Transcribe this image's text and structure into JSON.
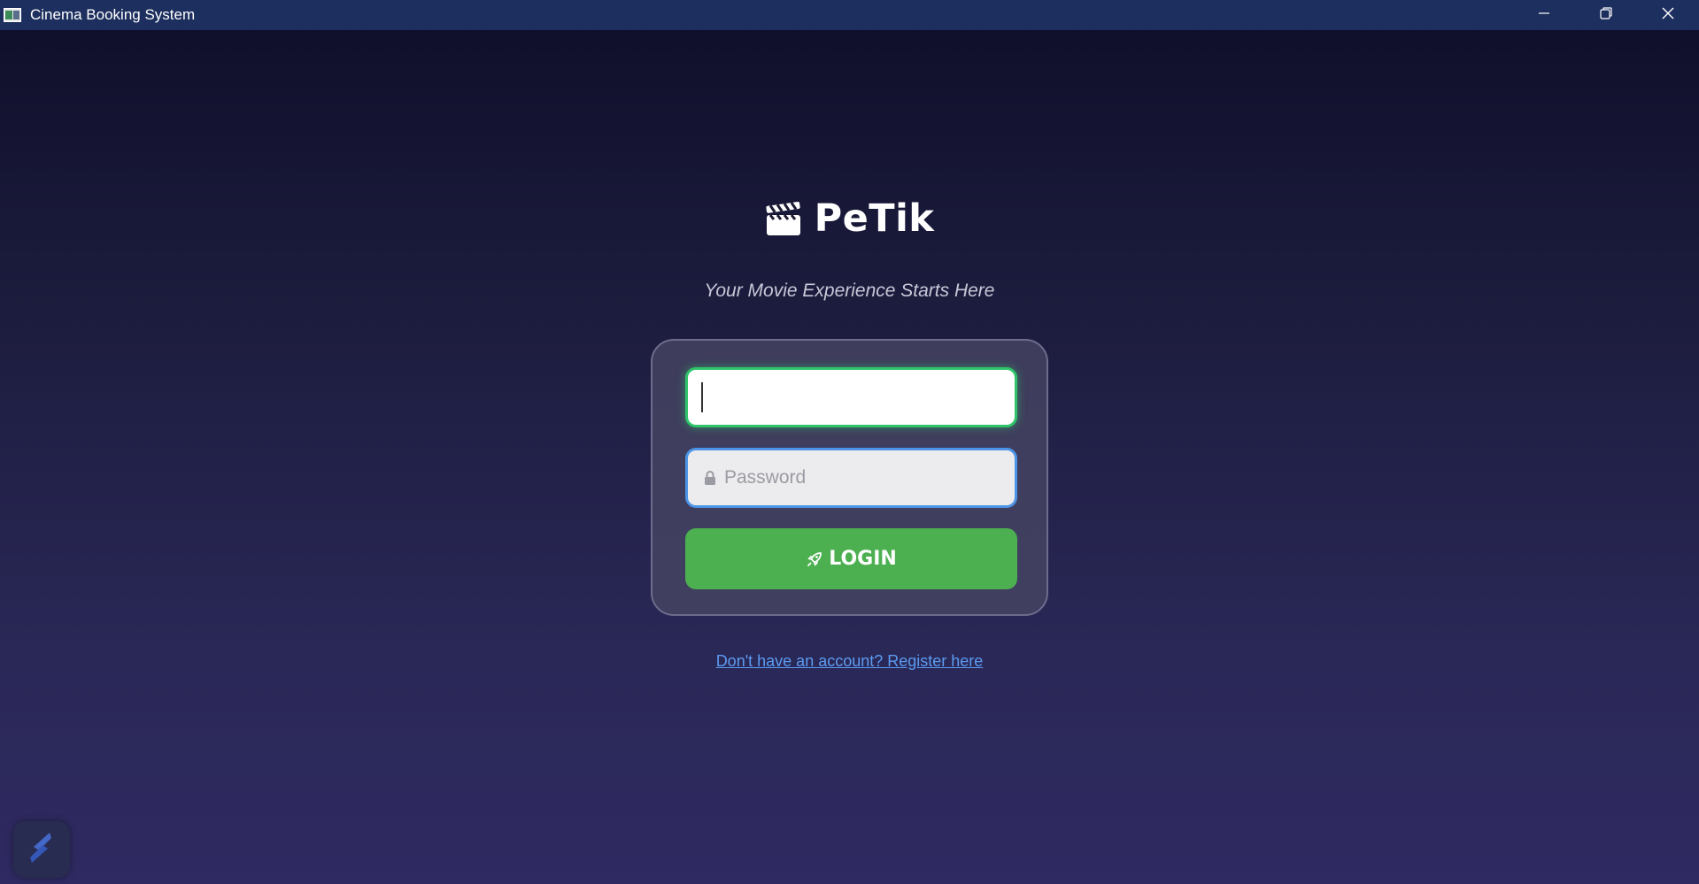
{
  "window": {
    "title": "Cinema Booking System"
  },
  "titlebar_controls": {
    "minimize_icon": "minimize-icon",
    "maximize_icon": "restore-icon",
    "close_icon": "close-icon"
  },
  "logo": {
    "icon": "clapperboard-icon",
    "text": "PeTik"
  },
  "tagline": "Your Movie Experience Starts Here",
  "login_form": {
    "username": {
      "value": "",
      "focused": true
    },
    "password": {
      "icon": "lock-icon",
      "placeholder": "Password",
      "value": ""
    },
    "login_button": {
      "icon": "rocket-icon",
      "label": "LOGIN"
    }
  },
  "register_link": "Don't have an account? Register here",
  "colors": {
    "titlebar": "#1d2f5e",
    "background_top": "#0f0e29",
    "background_bottom": "#2f2a62",
    "focus_green": "#2fc46a",
    "password_border": "#4c94e6",
    "login_button": "#4caf50",
    "link": "#5c9bf0"
  }
}
